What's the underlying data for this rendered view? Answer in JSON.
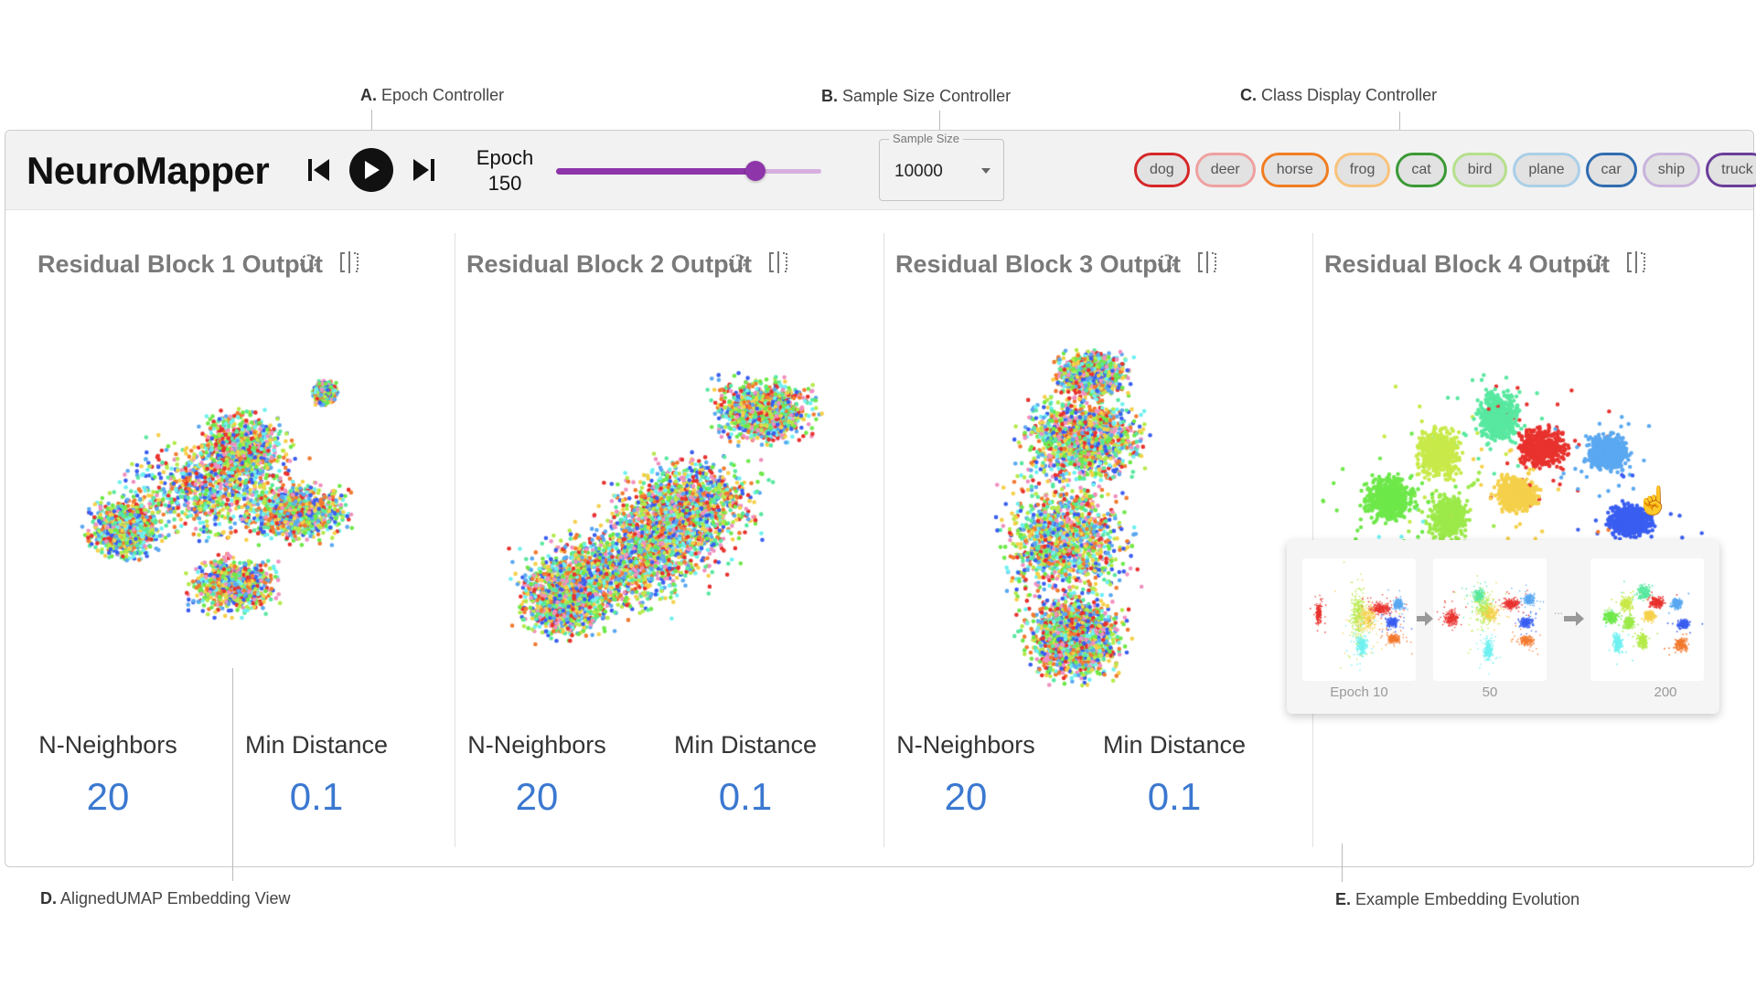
{
  "annotations": {
    "a": {
      "letter": "A.",
      "text": "Epoch Controller"
    },
    "b": {
      "letter": "B.",
      "text": "Sample Size Controller"
    },
    "c": {
      "letter": "C.",
      "text": "Class Display Controller"
    },
    "d": {
      "letter": "D.",
      "text": "AlignedUMAP Embedding View"
    },
    "e": {
      "letter": "E.",
      "text": "Example Embedding Evolution"
    }
  },
  "app": {
    "title": "NeuroMapper"
  },
  "epoch_controller": {
    "label": "Epoch",
    "value": "150",
    "slider_fraction": 0.75,
    "accent": "#8e35aa",
    "icons": [
      "skip-back-icon",
      "play-icon",
      "skip-forward-icon"
    ]
  },
  "sample_size": {
    "label": "Sample Size",
    "value": "10000"
  },
  "classes": [
    {
      "name": "dog",
      "color": "#d62728"
    },
    {
      "name": "deer",
      "color": "#f0a0a0"
    },
    {
      "name": "horse",
      "color": "#f07d22"
    },
    {
      "name": "frog",
      "color": "#f9c27a"
    },
    {
      "name": "cat",
      "color": "#3a9a35"
    },
    {
      "name": "bird",
      "color": "#b5e08c"
    },
    {
      "name": "plane",
      "color": "#aacfe8"
    },
    {
      "name": "car",
      "color": "#2f6cb0"
    },
    {
      "name": "ship",
      "color": "#c9b4dc"
    },
    {
      "name": "truck",
      "color": "#6a3d9a"
    }
  ],
  "blocks": [
    {
      "title": "Residual Block 1 Output",
      "n_neighbors_label": "N-Neighbors",
      "n_neighbors": "20",
      "min_distance_label": "Min Distance",
      "min_distance": "0.1"
    },
    {
      "title": "Residual Block 2 Output",
      "n_neighbors_label": "N-Neighbors",
      "n_neighbors": "20",
      "min_distance_label": "Min Distance",
      "min_distance": "0.1"
    },
    {
      "title": "Residual Block 3 Output",
      "n_neighbors_label": "N-Neighbors",
      "n_neighbors": "20",
      "min_distance_label": "Min Distance",
      "min_distance": "0.1"
    },
    {
      "title": "Residual Block 4 Output"
    }
  ],
  "evolution": {
    "captions": [
      "Epoch 10",
      "50",
      "200"
    ],
    "ellipsis": "..."
  }
}
